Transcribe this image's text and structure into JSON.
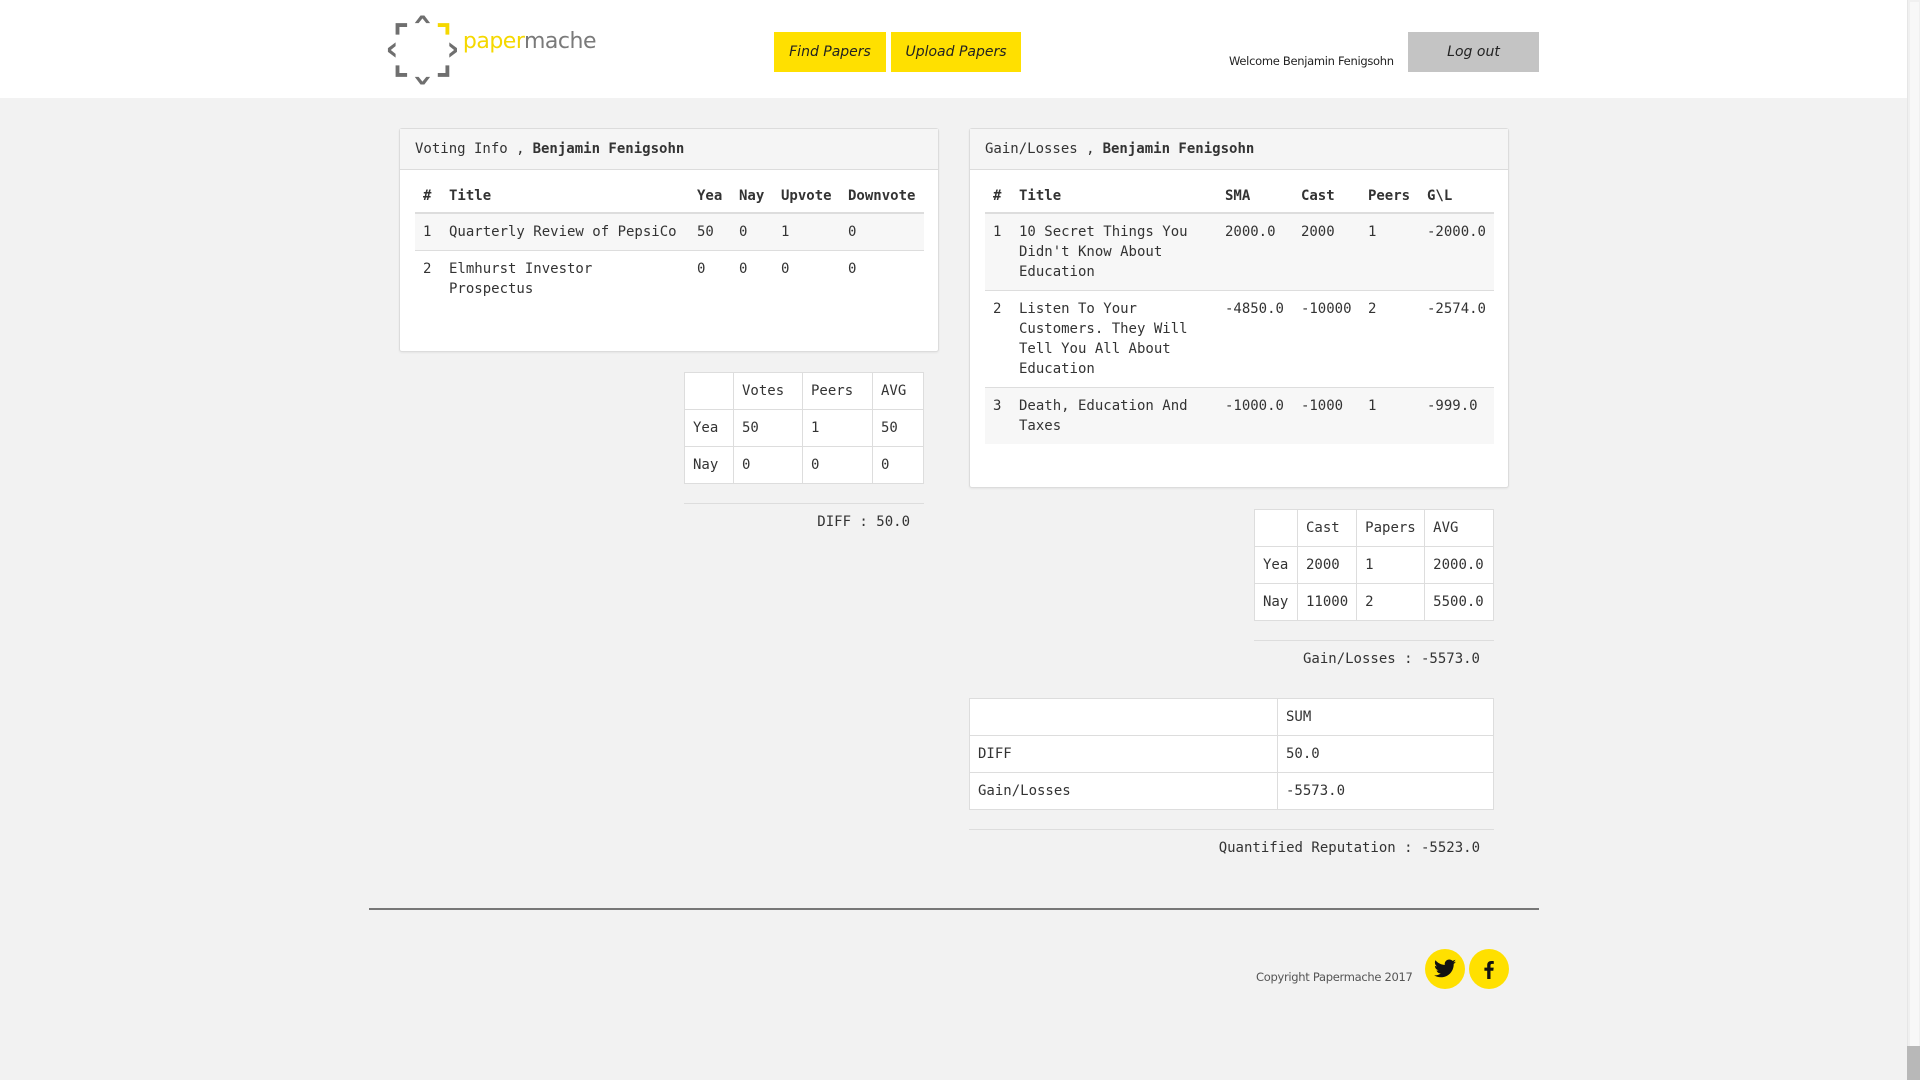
{
  "header": {
    "logo_part1": "paper",
    "logo_part2": "mache",
    "find_label": "Find Papers",
    "upload_label": "Upload Papers",
    "welcome_text": "Welcome Benjamin Fenigsohn",
    "logout_label": "Log out"
  },
  "voting": {
    "heading": "Voting Info ,",
    "user": "Benjamin Fenigsohn",
    "columns": [
      "#",
      "Title",
      "Yea",
      "Nay",
      "Upvote",
      "Downvote"
    ],
    "rows": [
      {
        "num": "1",
        "title": "Quarterly Review of PepsiCo",
        "yea": "50",
        "nay": "0",
        "upvote": "1",
        "downvote": "0"
      },
      {
        "num": "2",
        "title": "Elmhurst Investor Prospectus",
        "yea": "0",
        "nay": "0",
        "upvote": "0",
        "downvote": "0"
      }
    ],
    "summary": {
      "headers": [
        "",
        "Votes",
        "Peers",
        "AVG"
      ],
      "yea": [
        "Yea",
        "50",
        "1",
        "50"
      ],
      "nay": [
        "Nay",
        "0",
        "0",
        "0"
      ]
    },
    "diff_text": "DIFF : 50.0"
  },
  "gains": {
    "heading": "Gain/Losses ,",
    "user": "Benjamin Fenigsohn",
    "columns": [
      "#",
      "Title",
      "SMA",
      "Cast",
      "Peers",
      "G\\L"
    ],
    "rows": [
      {
        "num": "1",
        "title": "10 Secret Things You Didn't Know About Education",
        "sma": "2000.0",
        "cast": "2000",
        "peers": "1",
        "gl": "-2000.0"
      },
      {
        "num": "2",
        "title": "Listen To Your Customers. They Will Tell You All About Education",
        "sma": "-4850.0",
        "cast": "-10000",
        "peers": "2",
        "gl": "-2574.0"
      },
      {
        "num": "3",
        "title": "Death, Education And Taxes",
        "sma": "-1000.0",
        "cast": "-1000",
        "peers": "1",
        "gl": "-999.0"
      }
    ],
    "summary": {
      "headers": [
        "",
        "Cast",
        "Papers",
        "AVG"
      ],
      "yea": [
        "Yea",
        "2000",
        "1",
        "2000.0"
      ],
      "nay": [
        "Nay",
        "11000",
        "2",
        "5500.0"
      ]
    },
    "gl_text": "Gain/Losses : -5573.0"
  },
  "totals": {
    "header_blank": "",
    "header_sum": "SUM",
    "diff_label": "DIFF",
    "diff_value": "50.0",
    "gl_label": "Gain/Losses",
    "gl_value": "-5573.0",
    "reputation_text": "Quantified Reputation : -5523.0"
  },
  "footer": {
    "copyright": "Copyright Papermache 2017",
    "icons": [
      "twitter-icon",
      "facebook-icon"
    ]
  },
  "colors": {
    "accent": "#ffe000",
    "logo_gray": "#7a7a7a",
    "logout_bg": "#c4c4c4"
  }
}
